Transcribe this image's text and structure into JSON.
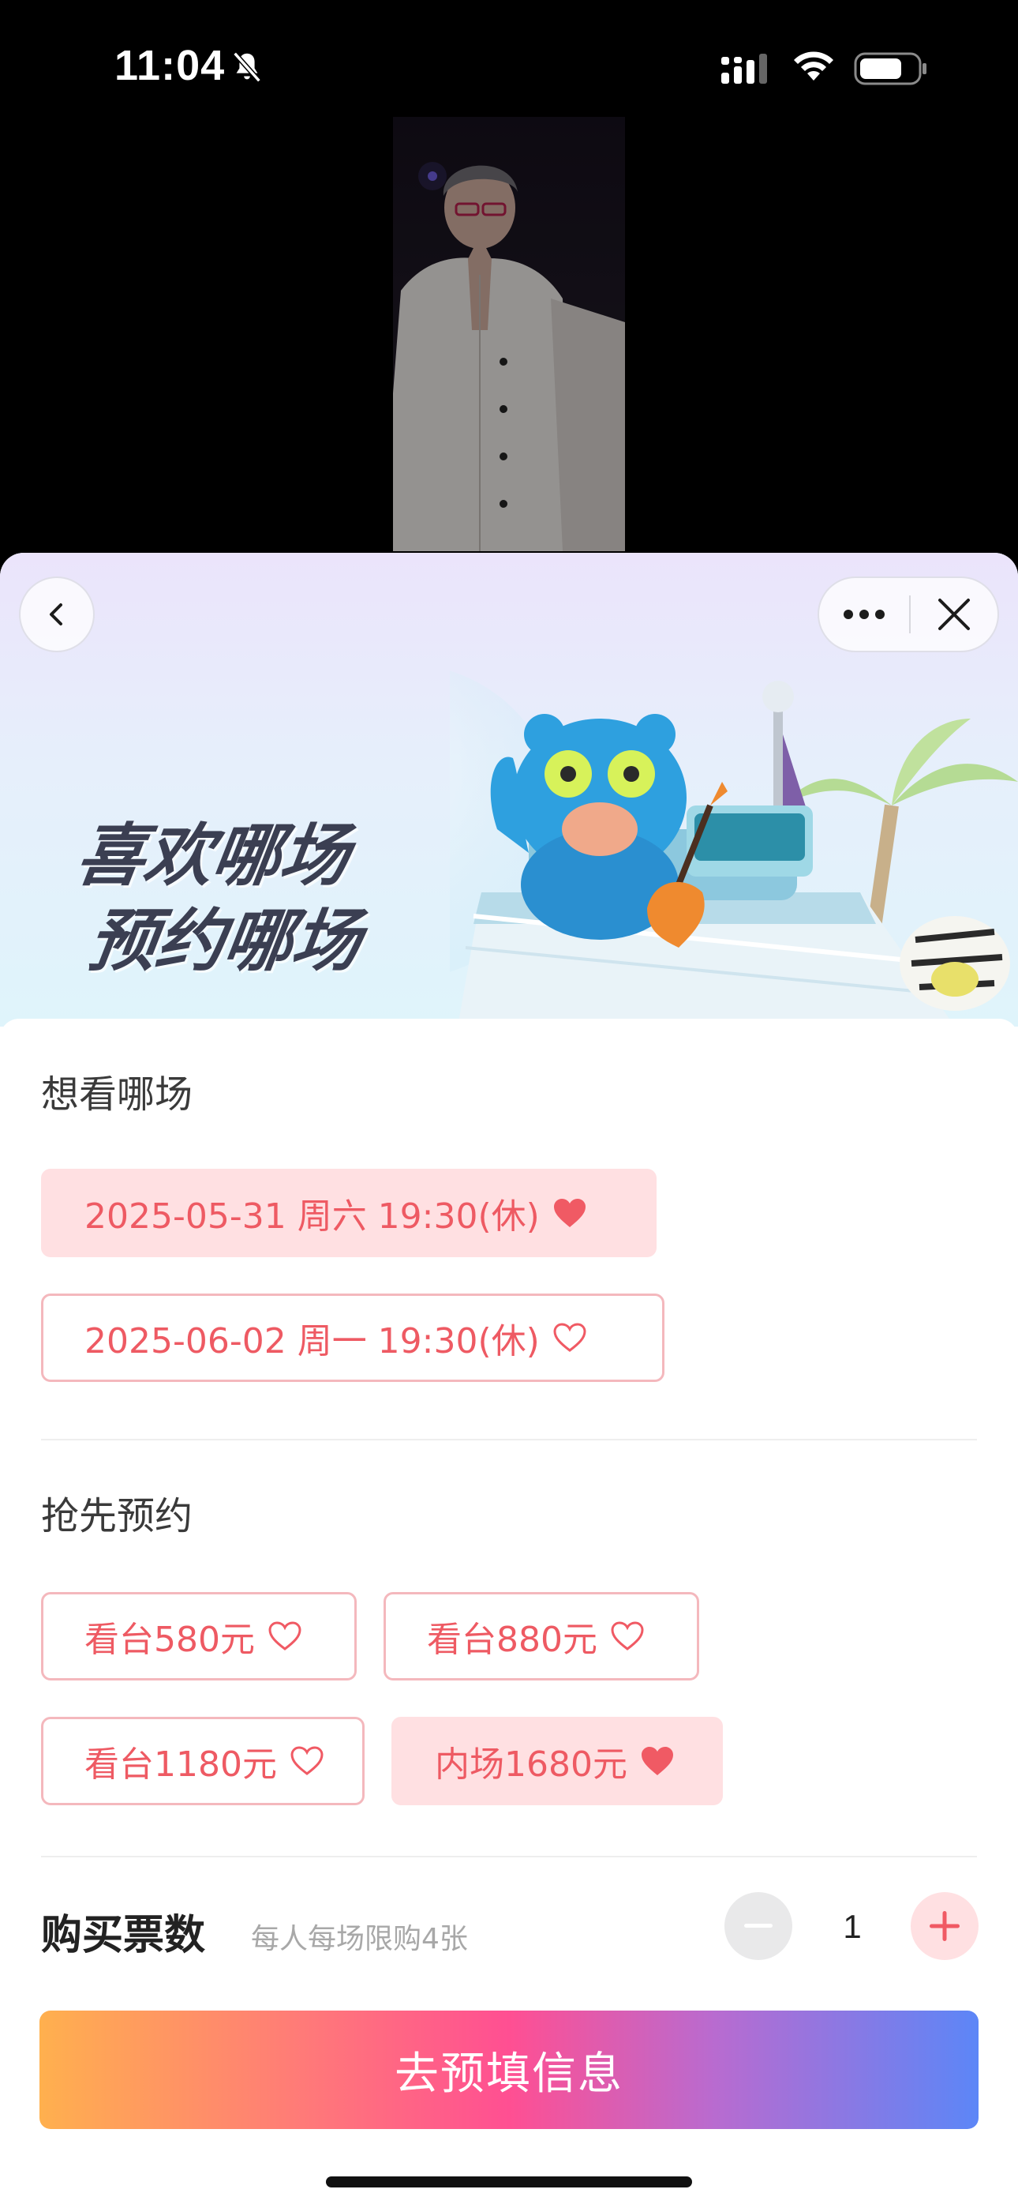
{
  "status_bar": {
    "time": "11:04",
    "icons": [
      "bell-slash-icon",
      "cellular-signal-icon",
      "wifi-icon",
      "battery-icon"
    ]
  },
  "banner": {
    "headline_line1": "喜欢哪场",
    "headline_line2": "预约哪场",
    "nav_icons": [
      "chevron-left-icon",
      "more-icon",
      "close-icon"
    ]
  },
  "session_section": {
    "title": "想看哪场",
    "options": [
      {
        "label": "2025-05-31 周六 19:30(休)",
        "selected": true
      },
      {
        "label": "2025-06-02 周一 19:30(休)",
        "selected": false
      }
    ]
  },
  "ticket_section": {
    "title": "抢先预约",
    "options": [
      {
        "label": "看台580元",
        "selected": false
      },
      {
        "label": "看台880元",
        "selected": false
      },
      {
        "label": "看台1180元",
        "selected": false
      },
      {
        "label": "内场1680元",
        "selected": true
      }
    ]
  },
  "quantity": {
    "label": "购买票数",
    "note": "每人每场限购4张",
    "value": "1"
  },
  "cta": {
    "label": "去预填信息"
  },
  "colors": {
    "accent": "#ee5a63",
    "chip_selected_bg": "#ffe0e2",
    "chip_border": "#f4b8bd"
  }
}
